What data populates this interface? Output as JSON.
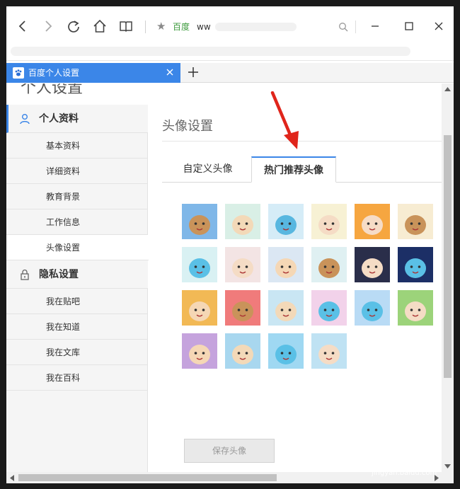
{
  "browser": {
    "site_name": "百度",
    "url": "ww",
    "tab_title": "百度个人设置",
    "new_tab_label": "+"
  },
  "page": {
    "title": "个人设置"
  },
  "sidebar": {
    "sections": [
      {
        "label": "个人资料",
        "icon": "user-icon",
        "items": [
          "基本资料",
          "详细资料",
          "教育背景",
          "工作信息",
          "头像设置"
        ]
      },
      {
        "label": "隐私设置",
        "icon": "lock-icon",
        "items": [
          "我在贴吧",
          "我在知道",
          "我在文库",
          "我在百科"
        ]
      }
    ],
    "selected_item": "头像设置"
  },
  "main": {
    "section_title": "头像设置",
    "tabs": [
      "自定义头像",
      "热门推荐头像"
    ],
    "active_tab": "热门推荐头像",
    "save_button": "保存头像",
    "avatar_count": 22
  },
  "watermark": {
    "title": "Bai 经验",
    "subtitle": "jingyan.baidu.com"
  },
  "colors": {
    "accent": "#3b86e8",
    "annotation_arrow": "#e0251b",
    "site_green": "#3c9a3c"
  }
}
